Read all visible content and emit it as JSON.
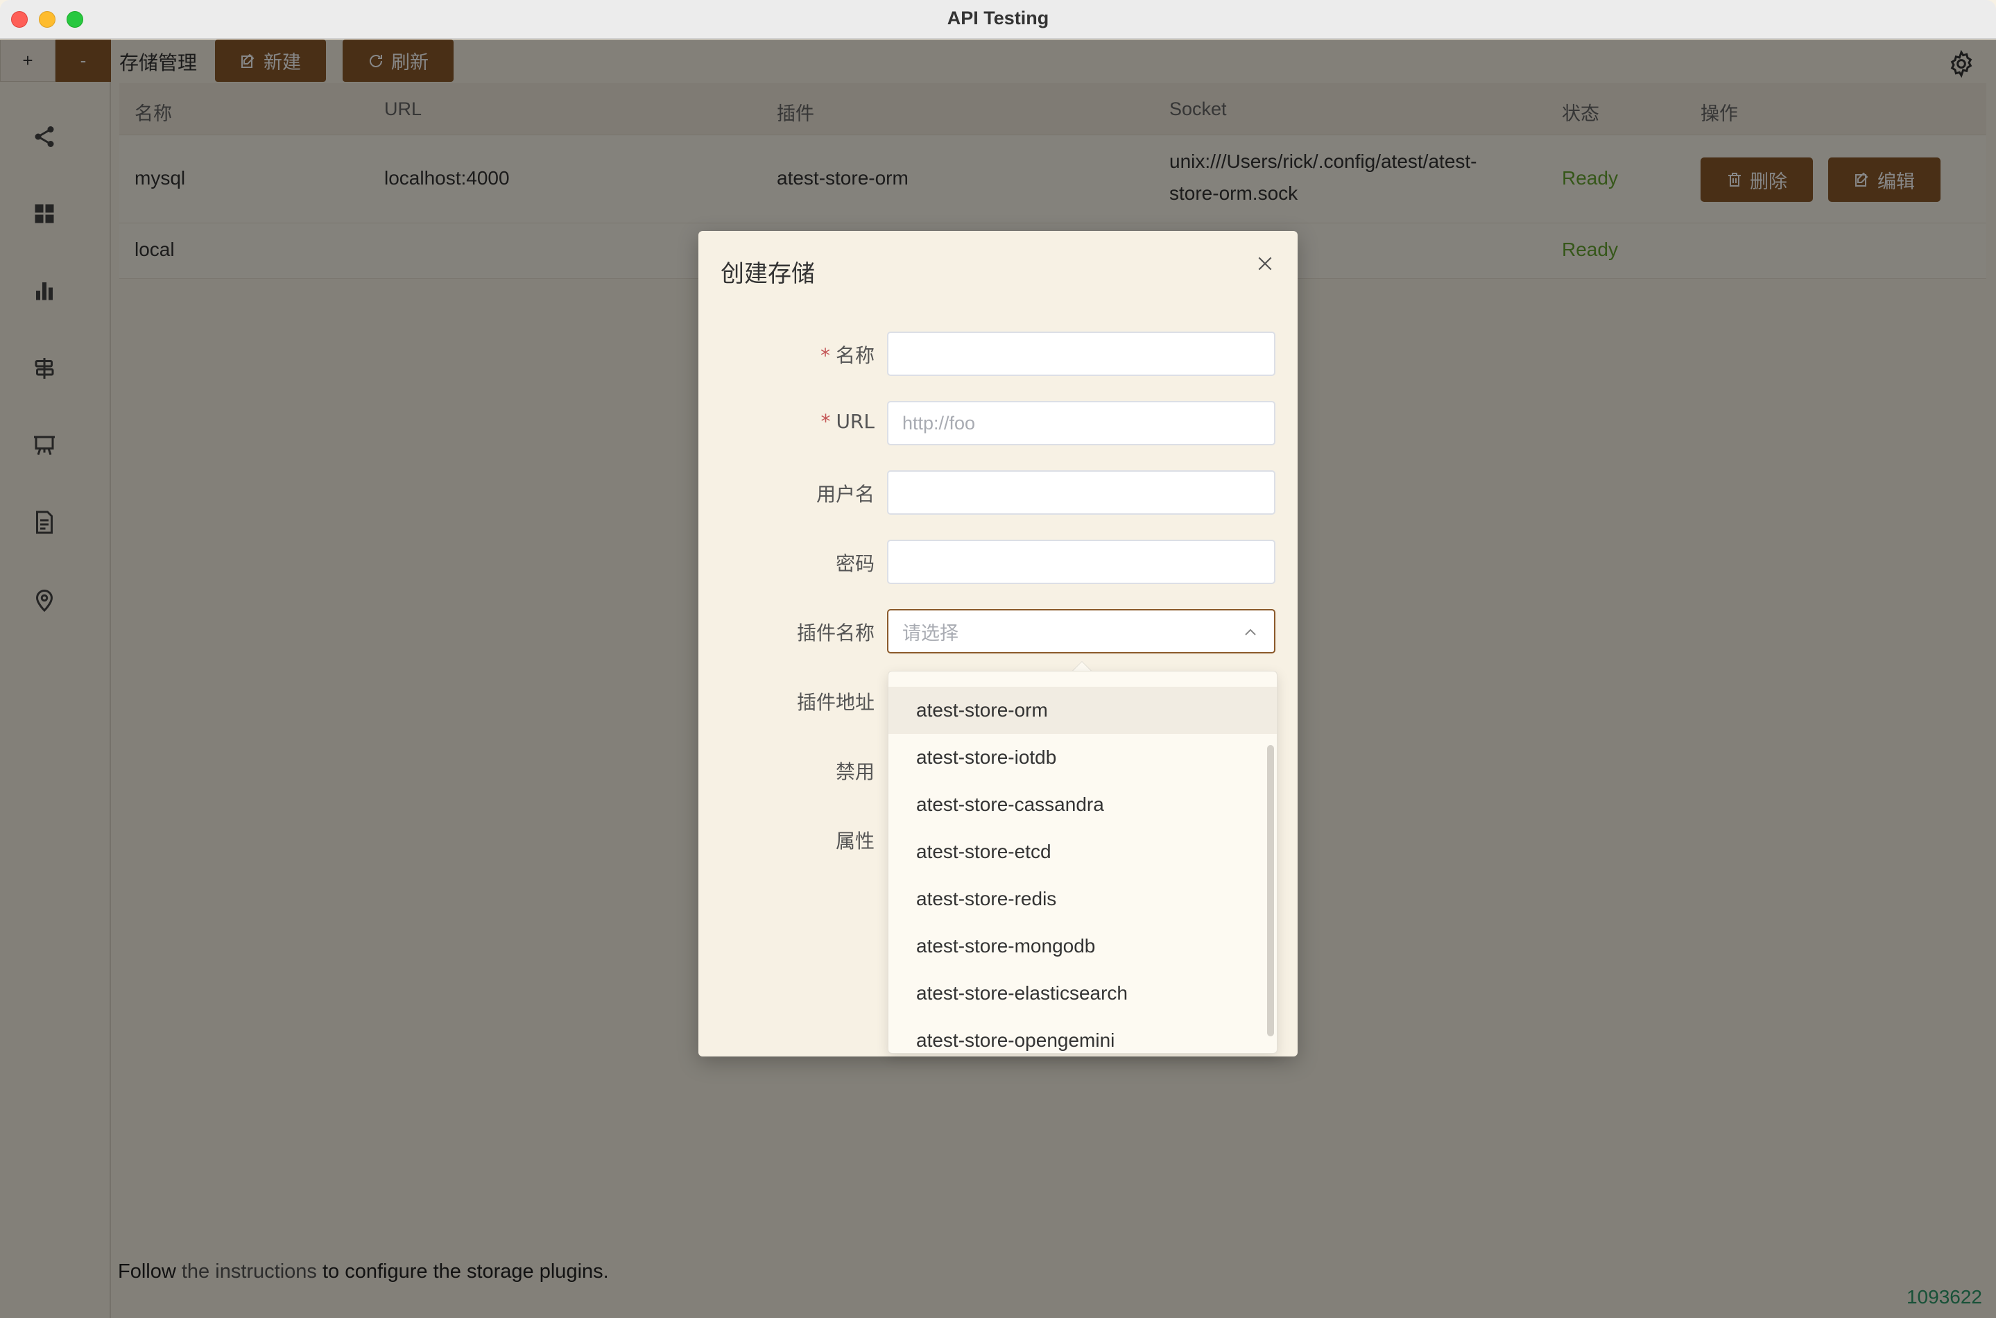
{
  "window": {
    "title": "API Testing"
  },
  "sidebar": {
    "collapse_plus": "+",
    "collapse_minus": "-",
    "items": [
      {
        "icon": "share-icon"
      },
      {
        "icon": "grid-icon"
      },
      {
        "icon": "bar-chart-icon"
      },
      {
        "icon": "signpost-icon"
      },
      {
        "icon": "presentation-icon"
      },
      {
        "icon": "document-icon"
      },
      {
        "icon": "location-pin-icon"
      }
    ]
  },
  "toolbar": {
    "title": "存储管理",
    "new_label": "新建",
    "refresh_label": "刷新",
    "settings_icon": "gear-icon"
  },
  "table": {
    "columns": [
      "名称",
      "URL",
      "插件",
      "Socket",
      "状态",
      "操作"
    ],
    "rows": [
      {
        "name": "mysql",
        "url": "localhost:4000",
        "plugin": "atest-store-orm",
        "socket_line1": "unix:///Users/rick/.config/atest/atest-",
        "socket_line2": "store-orm.sock",
        "status": "Ready",
        "delete_label": "删除",
        "edit_label": "编辑"
      },
      {
        "name": "local",
        "url": "",
        "plugin": "",
        "socket_line1": "",
        "socket_line2": "",
        "status": "Ready"
      }
    ]
  },
  "footer": {
    "note_prefix": "Follow",
    "note_link": "the instructions",
    "note_suffix": "to configure the storage plugins.",
    "version": "1093622"
  },
  "dialog": {
    "title": "创建存储",
    "fields": {
      "name_label": "名称",
      "name_value": "",
      "url_label": "URL",
      "url_placeholder": "http://foo",
      "username_label": "用户名",
      "username_value": "",
      "password_label": "密码",
      "password_value": "",
      "plugin_name_label": "插件名称",
      "plugin_name_placeholder": "请选择",
      "plugin_addr_label": "插件地址",
      "disabled_label": "禁用",
      "properties_label": "属性"
    },
    "required_mark": "*",
    "plugin_options": [
      "atest-store-orm",
      "atest-store-iotdb",
      "atest-store-cassandra",
      "atest-store-etcd",
      "atest-store-redis",
      "atest-store-mongodb",
      "atest-store-elasticsearch",
      "atest-store-opengemini"
    ]
  },
  "colors": {
    "accent": "#8b5a2b",
    "status_ready": "#67a532",
    "background": "#f7f1e4"
  }
}
